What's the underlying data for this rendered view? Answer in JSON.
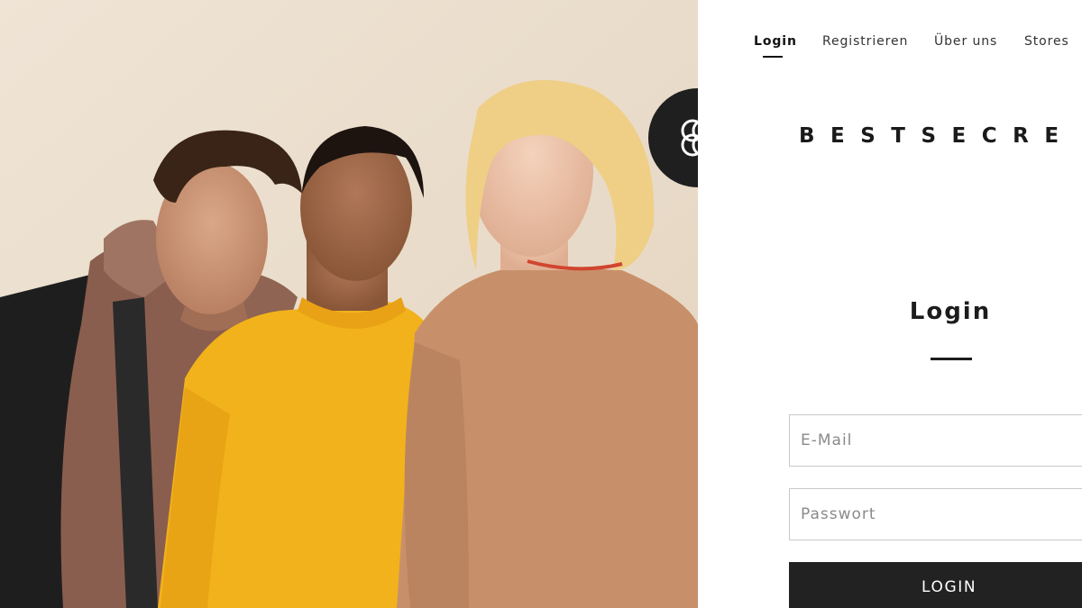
{
  "nav": {
    "items": [
      {
        "label": "Login",
        "active": true
      },
      {
        "label": "Registrieren",
        "active": false
      },
      {
        "label": "Über uns",
        "active": false
      },
      {
        "label": "Stores",
        "active": false
      }
    ]
  },
  "brand": {
    "wordmark": "BESTSECRE",
    "badge_icon": "bestsecret-knot-logo-icon"
  },
  "hero": {
    "image": "three-models-fashion-photo"
  },
  "login": {
    "title": "Login",
    "email_placeholder": "E-Mail",
    "password_placeholder": "Passwort",
    "submit_label": "LOGIN"
  },
  "colors": {
    "background": "#ffffff",
    "text": "#1a1a1a",
    "button": "#222222",
    "badge": "#1f1f1f",
    "hero_backdrop": "#ece0d0"
  }
}
